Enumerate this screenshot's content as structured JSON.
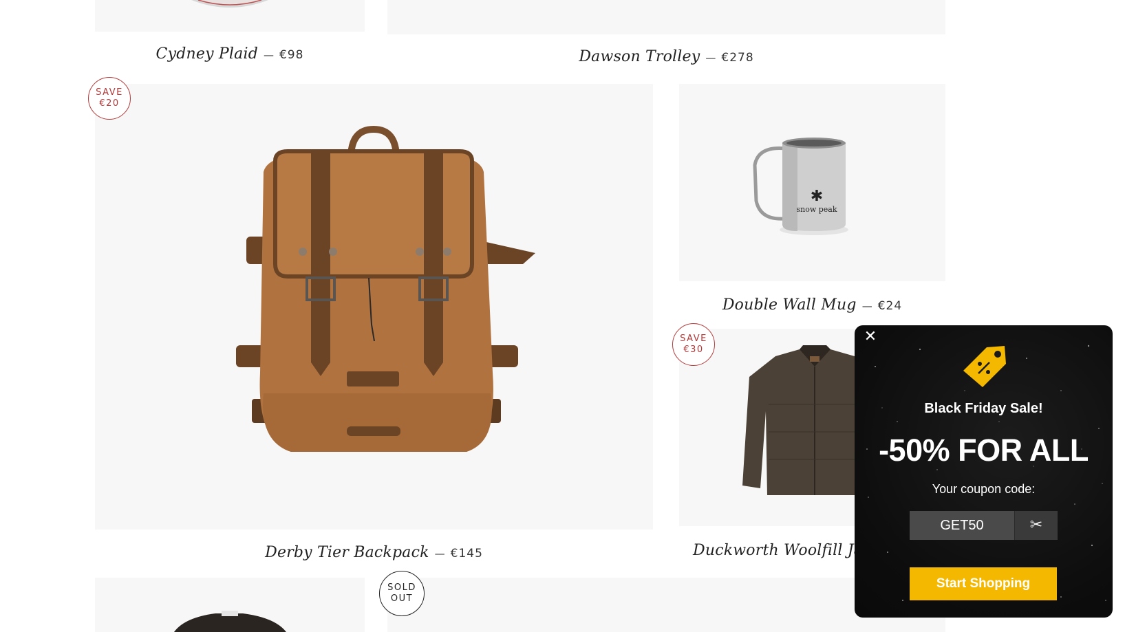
{
  "products": [
    {
      "name": "Cydney Plaid",
      "price": "€98"
    },
    {
      "name": "Dawson Trolley",
      "price": "€278"
    },
    {
      "name": "Derby Tier Backpack",
      "price": "€145",
      "badge": [
        "SAVE",
        "€20"
      ]
    },
    {
      "name": "Double Wall Mug",
      "price": "€24"
    },
    {
      "name": "Duckworth Woolfill Jack",
      "badge": [
        "SAVE",
        "€30"
      ]
    },
    {
      "badge": [
        "SOLD",
        "OUT"
      ]
    }
  ],
  "separator": "—",
  "popup": {
    "close_icon": "close-icon",
    "tag_icon": "discount-tag-icon",
    "heading": "Black Friday Sale!",
    "offer": "-50% FOR ALL",
    "coupon_label": "Your coupon code:",
    "coupon_code": "GET50",
    "copy_icon": "scissors-icon",
    "cta": "Start Shopping",
    "accent_color": "#f5b800"
  },
  "mug_brand": "snow peak"
}
